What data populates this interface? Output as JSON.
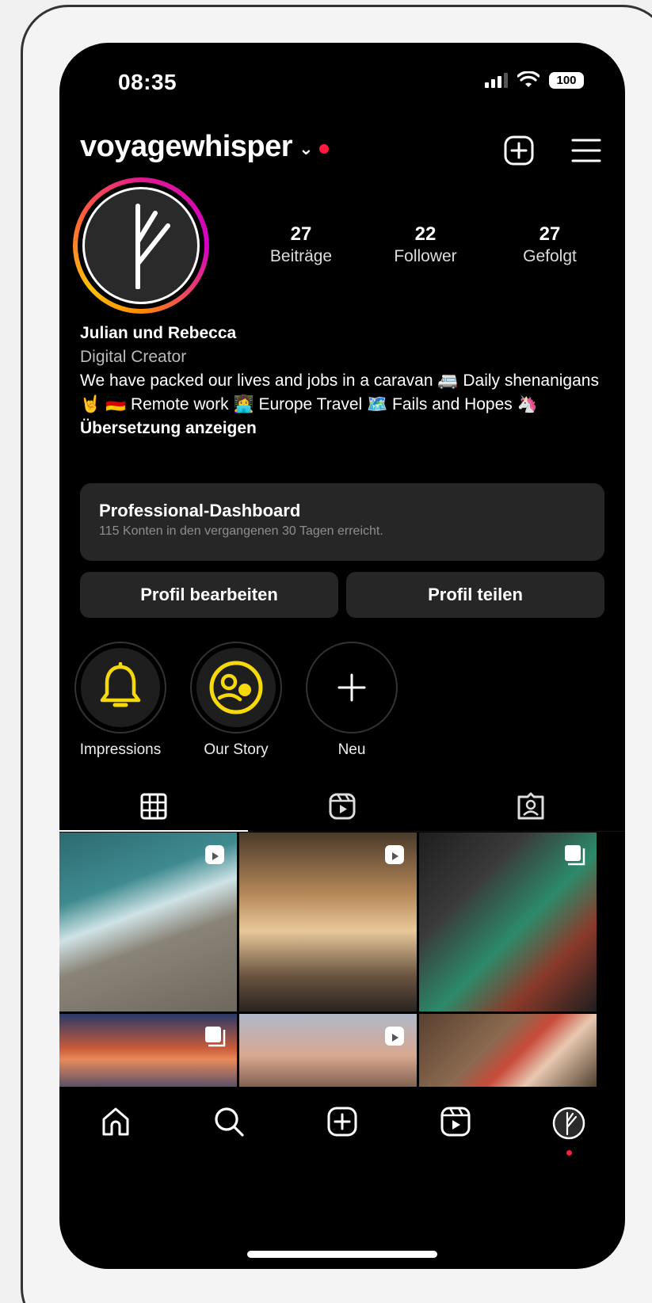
{
  "status": {
    "time": "08:35",
    "battery": "100"
  },
  "profile": {
    "username": "voyagewhisper",
    "stats": [
      {
        "value": "27",
        "label": "Beiträge"
      },
      {
        "value": "22",
        "label": "Follower"
      },
      {
        "value": "27",
        "label": "Gefolgt"
      }
    ],
    "name": "Julian und Rebecca",
    "category": "Digital Creator",
    "bio": "We have packed our lives and jobs in a caravan 🚐 Daily shenanigans 🤘 🇩🇪 Remote work 👩‍💻 Europe Travel 🗺️ Fails and Hopes 🦄",
    "translate": "Übersetzung anzeigen"
  },
  "dashboard": {
    "title": "Professional-Dashboard",
    "subtitle": "115 Konten in den vergangenen 30 Tagen erreicht."
  },
  "buttons": {
    "edit": "Profil bearbeiten",
    "share": "Profil teilen"
  },
  "highlights": [
    {
      "label": "Impressions",
      "icon": "bell-icon"
    },
    {
      "label": "Our Story",
      "icon": "face-icon"
    },
    {
      "label": "Neu",
      "icon": "plus-icon"
    }
  ],
  "tabs": [
    "grid-icon",
    "reels-icon",
    "tagged-icon"
  ],
  "nav": [
    "home-icon",
    "search-icon",
    "create-icon",
    "reels-icon",
    "profile-icon"
  ],
  "colors": {
    "accent_red": "#ff1a3e",
    "highlight_yellow": "#f5d90a",
    "surface": "#262626"
  }
}
